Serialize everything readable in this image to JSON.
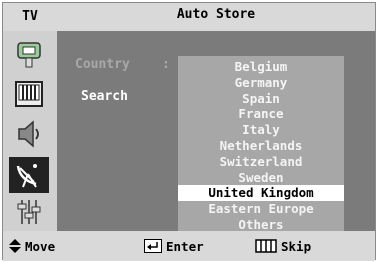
{
  "header": {
    "tv_label": "TV",
    "title": "Auto Store"
  },
  "sidebar": {
    "icons": [
      "input-icon",
      "picture-icon",
      "sound-icon",
      "channel-icon",
      "setup-icon"
    ],
    "active": "channel-icon"
  },
  "fields": {
    "country_label": "Country",
    "country_colon": ":",
    "search_label": "Search"
  },
  "dropdown": {
    "options": [
      "Belgium",
      "Germany",
      "Spain",
      "France",
      "Italy",
      "Netherlands",
      "Switzerland",
      "Sweden",
      "United Kingdom",
      "Eastern Europe",
      "Others"
    ],
    "selected": "United Kingdom"
  },
  "footer": {
    "move": "Move",
    "enter": "Enter",
    "skip": "Skip"
  },
  "colors": {
    "panel": "#7b7b7b",
    "dropdown": "#a7a7a7",
    "highlight": "#ffffff",
    "bar": "#d9d9d9"
  }
}
